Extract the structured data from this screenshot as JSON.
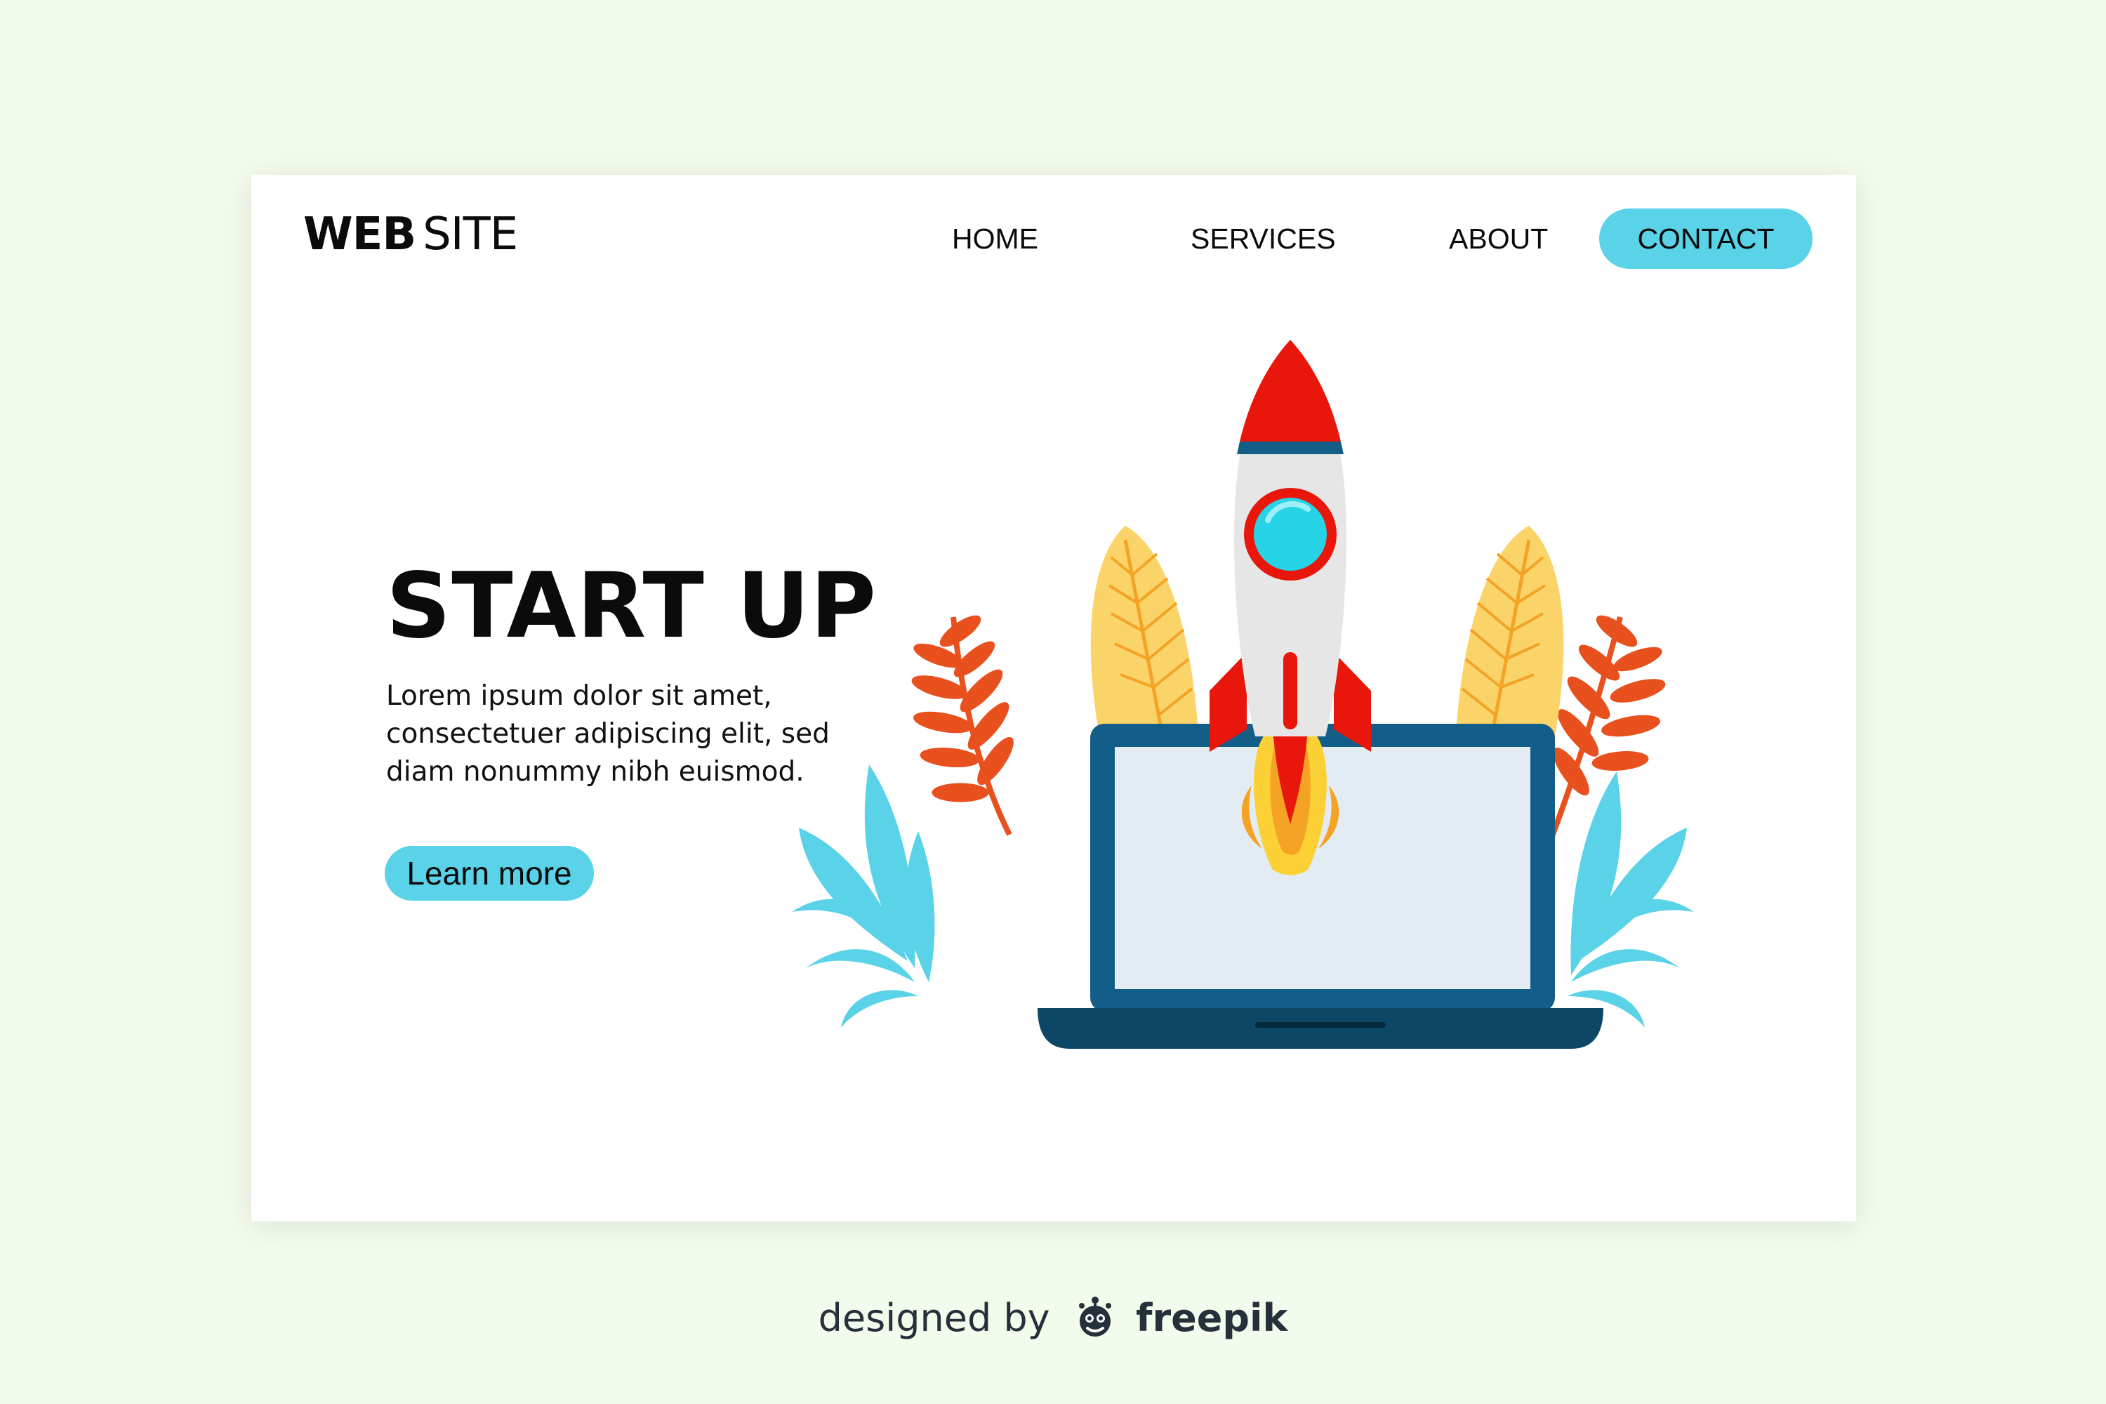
{
  "header": {
    "logo_bold": "WEB",
    "logo_light": "SITE"
  },
  "nav": {
    "items": [
      "HOME",
      "SERVICES",
      "ABOUT"
    ],
    "contact_label": "CONTACT"
  },
  "hero": {
    "title": "START UP",
    "body": "Lorem ipsum dolor sit amet, consectetuer adipiscing elit, sed diam nonummy nibh euismod.",
    "cta_label": "Learn more"
  },
  "footer": {
    "prefix": "designed by",
    "brand": "freepik"
  },
  "icons": {
    "rocket": "rocket-icon",
    "laptop": "laptop-icon",
    "freepik_logo": "freepik-logo-icon"
  },
  "colors": {
    "page_bg": "#f3fcec",
    "card_bg": "#ffffff",
    "accent": "#5ad2e8",
    "rocket_red": "#e8160b",
    "laptop_blue": "#135e88",
    "leaf_yellow": "#fbd469",
    "leaf_orange": "#e8501e",
    "leaf_blue": "#5ad2e8"
  }
}
